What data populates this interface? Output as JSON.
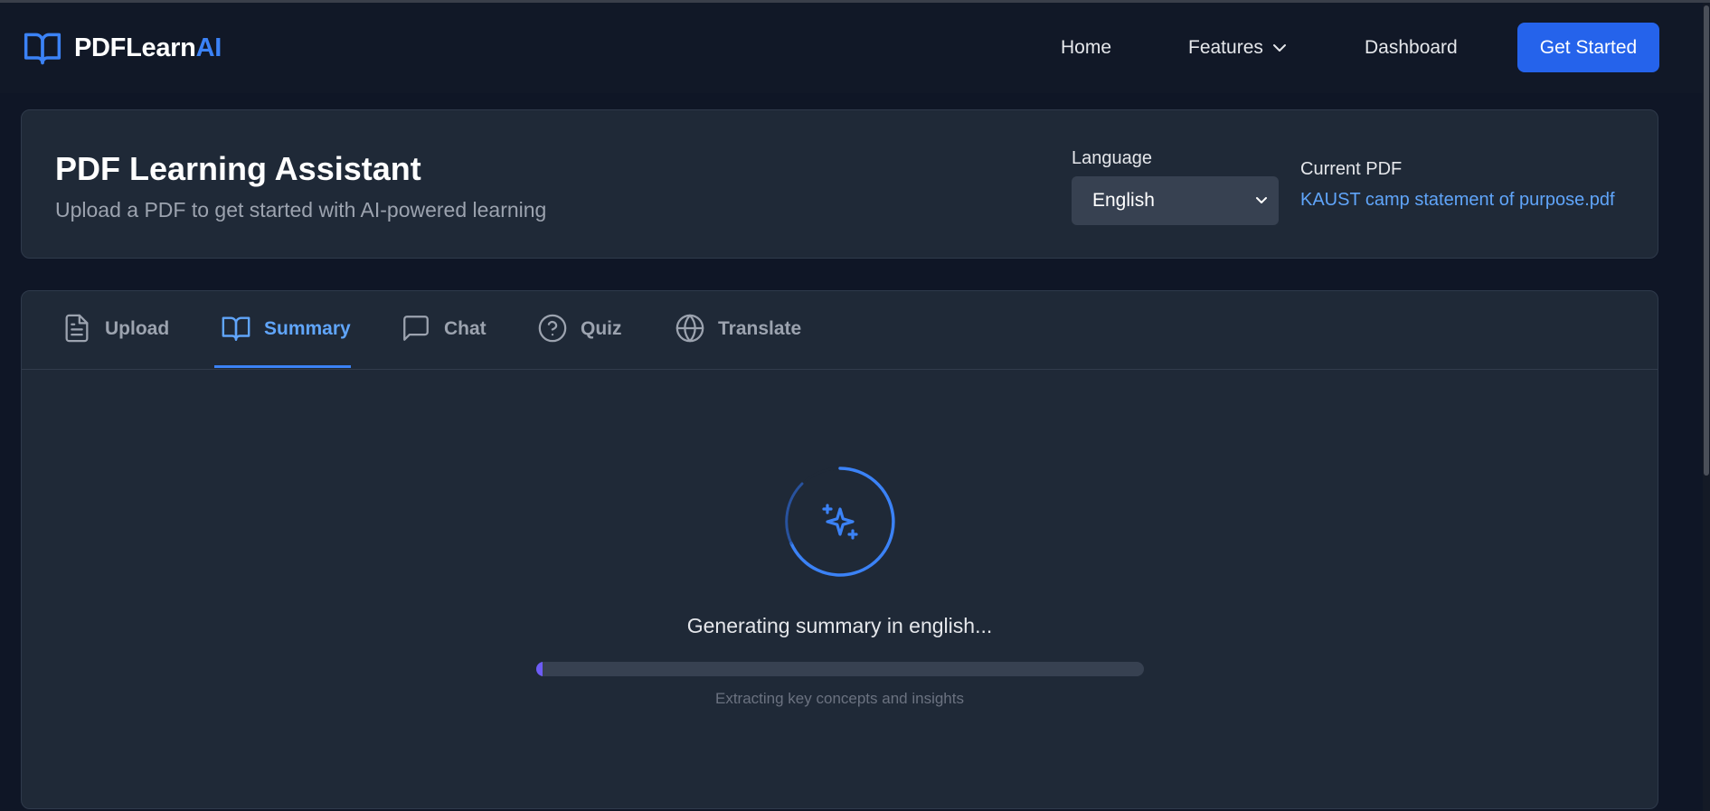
{
  "brand": {
    "name_main": "PDFLearn",
    "name_accent": "AI",
    "accent_color": "#3b82f6"
  },
  "nav": {
    "home": "Home",
    "features": "Features",
    "dashboard": "Dashboard",
    "cta": "Get Started"
  },
  "header": {
    "title": "PDF Learning Assistant",
    "subtitle": "Upload a PDF to get started with AI-powered learning",
    "language_label": "Language",
    "language_value": "English",
    "current_pdf_label": "Current PDF",
    "current_pdf_name": "KAUST camp statement of purpose.pdf"
  },
  "tabs": [
    {
      "label": "Upload",
      "icon": "file-text-icon"
    },
    {
      "label": "Summary",
      "icon": "book-open-icon",
      "active": true
    },
    {
      "label": "Chat",
      "icon": "message-square-icon"
    },
    {
      "label": "Quiz",
      "icon": "help-circle-icon"
    },
    {
      "label": "Translate",
      "icon": "globe-icon"
    }
  ],
  "loading": {
    "icon": "sparkles-icon",
    "message": "Generating summary in english...",
    "detail": "Extracting key concepts and insights",
    "progress_percent": 1
  },
  "colors": {
    "background": "#0f1626",
    "card": "#1f2937",
    "primary": "#2563eb",
    "link": "#60a5fa",
    "progress": "#6d5cf6"
  }
}
